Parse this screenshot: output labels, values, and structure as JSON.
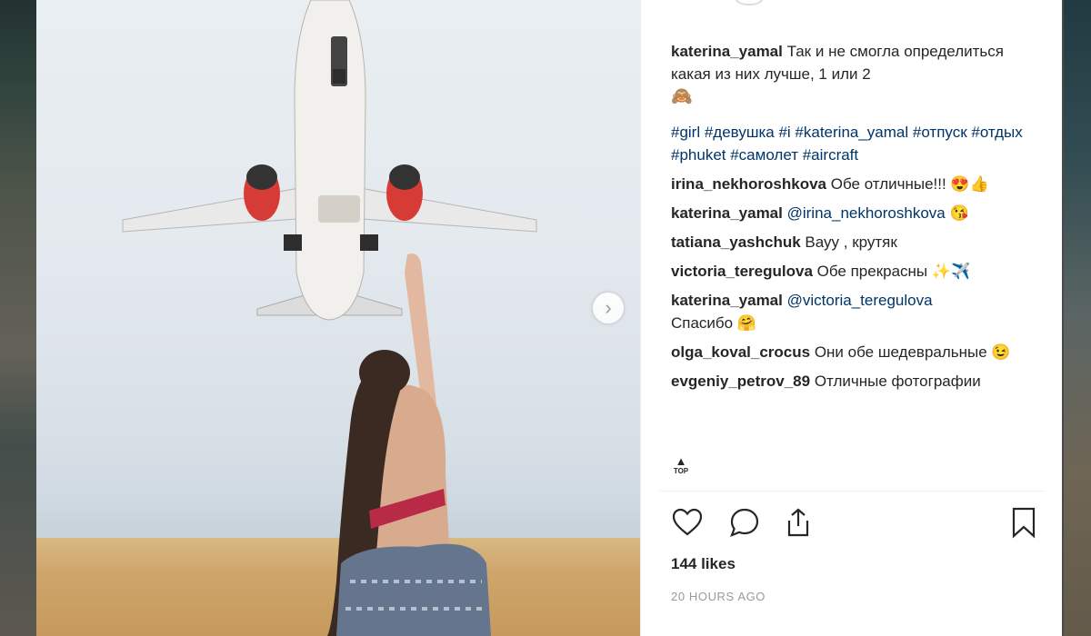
{
  "post": {
    "caption": {
      "user": "katerina_yamal",
      "text": "Так и не смогла определиться какая из них лучше, 1 или 2",
      "emoji": "🙈",
      "hashtags": "#girl #девушка #i #katerina_yamal #отпуск #отдых #phuket #самолет #aircraft"
    },
    "comments": [
      {
        "user": "irina_nekhoroshkova",
        "text": "Обе отличные!!! 😍👍"
      },
      {
        "user": "katerina_yamal",
        "mention": "@irina_nekhoroshkova",
        "text": "😘"
      },
      {
        "user": "tatiana_yashchuk",
        "text": "Вауу , крутяк"
      },
      {
        "user": "victoria_teregulova",
        "text": "Обе прекрасны ✨✈️"
      },
      {
        "user": "katerina_yamal",
        "mention": "@victoria_teregulova",
        "text": "Спасибо 🤗"
      },
      {
        "user": "olga_koval_crocus",
        "text": "Они обе шедевральные 😉"
      },
      {
        "user": "evgeniy_petrov_89",
        "text": "Отличные фотографии"
      }
    ],
    "top_button": "TOP",
    "likes": "144 likes",
    "timestamp": "20 HOURS AGO"
  },
  "icons": {
    "like": "heart-icon",
    "comment": "comment-bubble-icon",
    "share": "share-icon",
    "save": "bookmark-icon",
    "next": "chevron-right-icon",
    "top": "arrow-up-icon"
  },
  "colors": {
    "text": "#262626",
    "link": "#003569",
    "muted": "#999999"
  }
}
